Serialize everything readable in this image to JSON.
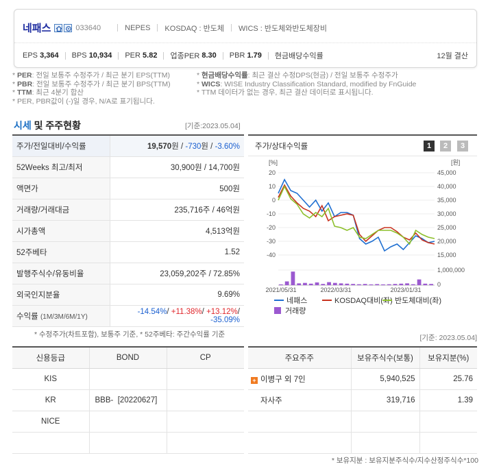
{
  "header": {
    "company_name": "네패스",
    "ticker": "033640",
    "english_name": "NEPES",
    "market": "KOSDAQ : 반도체",
    "wics": "WICS : 반도체와반도체장비",
    "eps_label": "EPS",
    "eps_value": "3,364",
    "bps_label": "BPS",
    "bps_value": "10,934",
    "per_label": "PER",
    "per_value": "5.82",
    "industry_per_label": "업종PER",
    "industry_per_value": "8.30",
    "pbr_label": "PBR",
    "pbr_value": "1.79",
    "dividend_label": "현금배당수익률",
    "settlement": "12월 결산"
  },
  "notes": {
    "left": [
      {
        "key": "PER",
        "text": ": 전일 보통주 수정주가 / 최근 분기 EPS(TTM)"
      },
      {
        "key": "PBR",
        "text": ": 전일 보통주 수정주가 / 최근 분기 BPS(TTM)"
      },
      {
        "key": "TTM",
        "text": ": 최근 4분기 합산"
      },
      {
        "key": "",
        "text": "PER, PBR값이 (-)일 경우, N/A로 표기됩니다."
      }
    ],
    "right": [
      {
        "key": "현금배당수익률",
        "text": ": 최근 결산 수정DPS(현금) / 전일 보통주 수정주가"
      },
      {
        "key": "WICS",
        "text": ": WISE Industry Classification Standard, modified by FnGuide"
      },
      {
        "key": "",
        "text": "TTM 데이터가 없는 경우, 최근 결산 데이터로 표시됩니다."
      }
    ]
  },
  "section": {
    "title_highlight": "시세",
    "title_rest": " 및 주주현황",
    "base_date": "[기준:2023.05.04]"
  },
  "price_table": {
    "price_label": "주가/전일대비/수익률",
    "price": "19,570",
    "price_unit": "원 / ",
    "change": "-730",
    "change_unit": "원 / ",
    "change_pct": "-3.60%",
    "rows": [
      {
        "label": "52Weeks 최고/최저",
        "value": "30,900원 / 14,700원"
      },
      {
        "label": "액면가",
        "value": "500원"
      },
      {
        "label": "거래량/거래대금",
        "value": "235,716주 / 46억원"
      },
      {
        "label": "시가총액",
        "value": "4,513억원"
      },
      {
        "label": "52주베타",
        "value": "1.52"
      },
      {
        "label": "발행주식수/유동비율",
        "value": "23,059,202주 / 72.85%"
      },
      {
        "label": "외국인지분율",
        "value": "9.69%"
      }
    ],
    "return_label": "수익률",
    "return_periods": "(1M/3M/6M/1Y)",
    "r1": "-14.54%",
    "r2": "+11.38%",
    "r3": "+13.12%",
    "r4": "-35.09%",
    "sep": "/ ",
    "footnote": "* 수정주가(차트포함), 보통주 기준, * 52주베타: 주간수익률 기준"
  },
  "chart_panel": {
    "title": "주가/상대수익률",
    "pages": [
      "1",
      "2",
      "3"
    ]
  },
  "chart_data": {
    "type": "line",
    "x_ticks": [
      "2021/05/31",
      "2022/03/31",
      "2023/01/31"
    ],
    "left_axis": {
      "unit": "[%]",
      "ticks": [
        20,
        10,
        0,
        -10,
        -20,
        -30,
        -40
      ],
      "ylim": [
        -40,
        20
      ]
    },
    "right_axis": {
      "unit": "[원]",
      "ticks": [
        "45,000",
        "40,000",
        "35,000",
        "30,000",
        "25,000",
        "20,000",
        "15,000"
      ],
      "ylim": [
        15000,
        45000
      ]
    },
    "volume_axis": {
      "ticks": [
        "1,000,000",
        "0"
      ]
    },
    "series": [
      {
        "name": "네패스",
        "color": "#1f6fd1",
        "values": [
          5,
          15,
          7,
          5,
          0,
          -5,
          0,
          -8,
          -2,
          -12,
          -9,
          -9,
          -11,
          -28,
          -32,
          -30,
          -27,
          -37,
          -34,
          -32,
          -36,
          -31,
          -26,
          -28,
          -31,
          -30
        ]
      },
      {
        "name": "KOSDAQ대비(좌)",
        "color": "#c8321e",
        "values": [
          2,
          11,
          3,
          -2,
          -6,
          -8,
          -12,
          -4,
          -15,
          -12,
          -11,
          -10,
          -11,
          -25,
          -30,
          -26,
          -22,
          -20,
          -20,
          -23,
          -27,
          -29,
          -24,
          -29,
          -31,
          -32
        ]
      },
      {
        "name": "반도체대비(좌)",
        "color": "#8cbf2a",
        "values": [
          0,
          10,
          1,
          -3,
          -10,
          -13,
          -9,
          -12,
          -6,
          -19,
          -20,
          -22,
          -20,
          -27,
          -28,
          -25,
          -22,
          -22,
          -22,
          -24,
          -27,
          -32,
          -22,
          -25,
          -27,
          -28
        ]
      }
    ],
    "volume_series": {
      "name": "거래량",
      "color": "#9b59d0",
      "values": [
        0.05,
        0.25,
        0.9,
        0.12,
        0.15,
        0.1,
        0.18,
        0.08,
        0.2,
        0.15,
        0.12,
        0.1,
        0.08,
        0.06,
        0.08,
        0.05,
        0.07,
        0.05,
        0.06,
        0.08,
        0.1,
        0.12,
        0.06,
        0.38,
        0.1,
        0.08
      ]
    }
  },
  "base_date2": "[기준: 2023.05.04]",
  "credit_table": {
    "headers": [
      "신용등급",
      "BOND",
      "CP"
    ],
    "rows": [
      {
        "agency": "KIS",
        "bond": "",
        "cp": ""
      },
      {
        "agency": "KR",
        "bond": "BBB-  [20220627]",
        "cp": ""
      },
      {
        "agency": "NICE",
        "bond": "",
        "cp": ""
      },
      {
        "agency": "",
        "bond": "",
        "cp": ""
      }
    ]
  },
  "holder_table": {
    "headers": [
      "주요주주",
      "보유주식수(보통)",
      "보유지분(%)"
    ],
    "rows": [
      {
        "name": "이병구 외 7인",
        "shares": "5,940,525",
        "pct": "25.76"
      },
      {
        "name": "자사주",
        "shares": "319,716",
        "pct": "1.39"
      },
      {
        "name": "",
        "shares": "",
        "pct": ""
      },
      {
        "name": "",
        "shares": "",
        "pct": ""
      }
    ],
    "footnote": "* 보유지분 : 보유지분주식수/지수산정주식수*100"
  }
}
